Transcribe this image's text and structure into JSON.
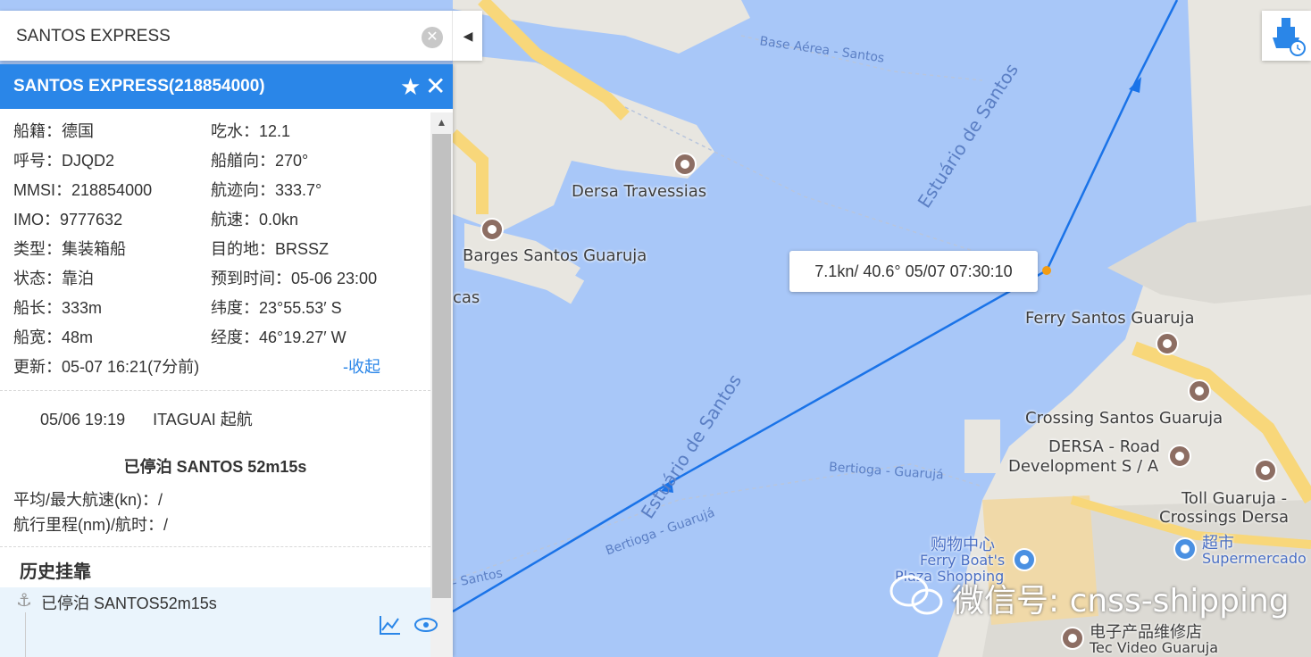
{
  "search": {
    "value": "SANTOS EXPRESS"
  },
  "panel": {
    "title": "SANTOS EXPRESS(218854000)",
    "rows": [
      {
        "left_label": "船籍：",
        "left_value": "德国",
        "right_label": "吃水：",
        "right_value": "12.1"
      },
      {
        "left_label": "呼号：",
        "left_value": "DJQD2",
        "right_label": "船艏向：",
        "right_value": "270°"
      },
      {
        "left_label": "MMSI：",
        "left_value": "218854000",
        "right_label": "航迹向：",
        "right_value": "333.7°"
      },
      {
        "left_label": "IMO：",
        "left_value": "9777632",
        "right_label": "航速：",
        "right_value": "0.0kn"
      },
      {
        "left_label": "类型：",
        "left_value": "集装箱船",
        "right_label": "目的地：",
        "right_value": "BRSSZ"
      },
      {
        "left_label": "状态：",
        "left_value": "靠泊",
        "right_label": "预到时间：",
        "right_value": "05-06 23:00"
      },
      {
        "left_label": "船长：",
        "left_value": "333m",
        "right_label": "纬度：",
        "right_value": "23°55.53′ S"
      },
      {
        "left_label": "船宽：",
        "left_value": "48m",
        "right_label": "经度：",
        "right_value": "46°19.27′ W"
      }
    ],
    "update_label": "更新：",
    "update_value": "05-07 16:21(7分前)",
    "collapse_link": "-收起",
    "voyage": {
      "time": "05/06 19:19",
      "port": "ITAGUAI 起航"
    },
    "status": "已停泊  SANTOS  52m15s",
    "avg_speed": "平均/最大航速(kn)：/",
    "distance": "航行里程(nm)/航时：/",
    "history_title": "历史挂靠",
    "history_item": "已停泊 SANTOS52m15s"
  },
  "map": {
    "tooltip": "7.1kn/ 40.6°  05/07 07:30:10",
    "labels": {
      "base_aerea": "Base Aérea - Santos",
      "estuario_top": "Estuário de Santos",
      "estuario_bottom": "Estuário de Santos",
      "dersa_travessias": "Dersa Travessias",
      "barges": "Barges Santos Guaruja",
      "cas": "cas",
      "ferry_santos": "Ferry Santos Guaruja",
      "crossing": "Crossing Santos Guaruja",
      "dersa_road_1": "DERSA - Road",
      "dersa_road_2": "Development S / A",
      "toll_1": "Toll Guaruja -",
      "toll_2": "Crossings Dersa",
      "bertioga_1": "Bertioga - Guarujá",
      "bertioga_2": "Bertioga - Guarujá",
      "santos_small": "- Santos",
      "shopping_cn": "购物中心",
      "ferry_boats_1": "Ferry Boat's",
      "ferry_boats_2": "Plaza Shopping",
      "supermarket_cn": "超市",
      "supermarket": "Supermercado",
      "repair_cn": "电子产品维修店",
      "tec_video": "Tec Video Guaruja"
    },
    "colors": {
      "water": "#a8c7f8",
      "land": "#e8e6e0",
      "road": "#f8d77a",
      "track": "#1a73e8"
    }
  },
  "watermark": "微信号: cnss-shipping"
}
